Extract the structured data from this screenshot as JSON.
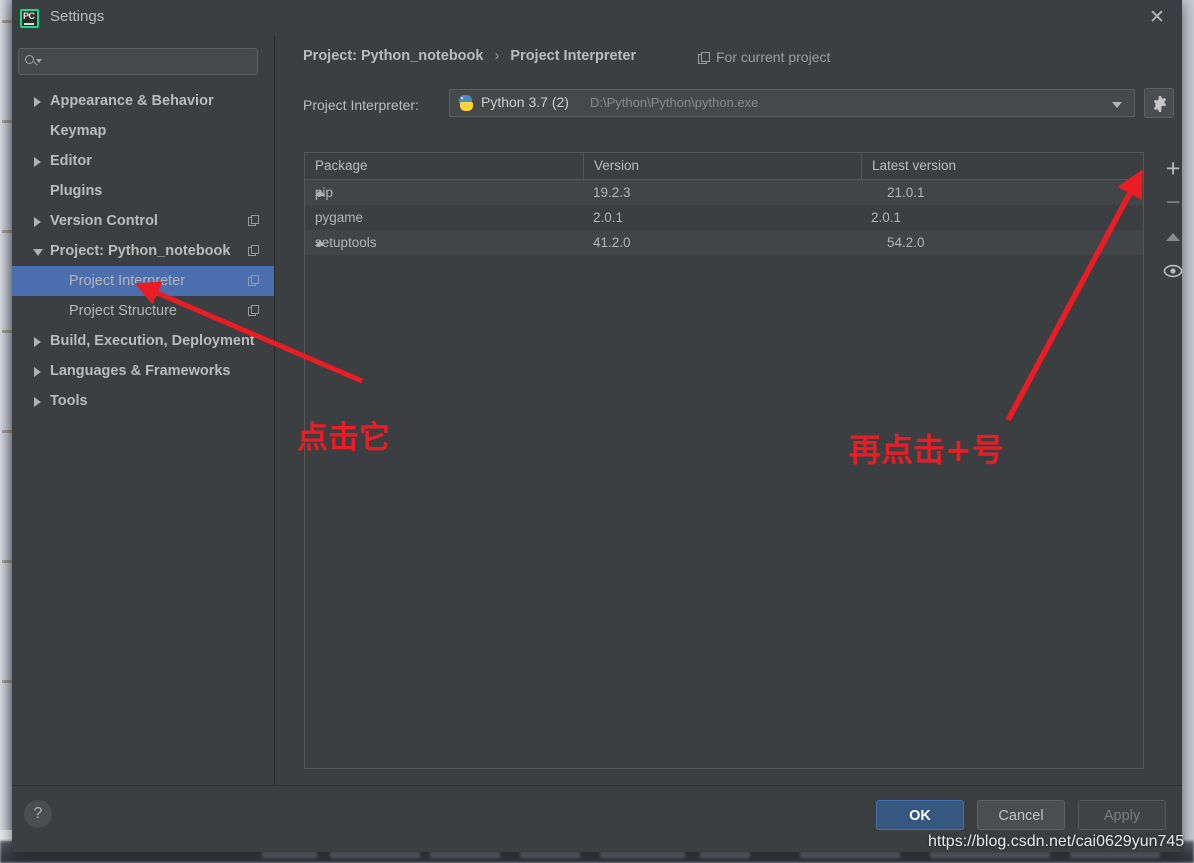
{
  "window": {
    "title": "Settings",
    "logo_icon": "pycharm-logo-icon",
    "close_icon": "close-icon"
  },
  "sidebar": {
    "search": {
      "value": "",
      "placeholder": "",
      "icon": "search-icon"
    },
    "items": [
      {
        "label": "Appearance & Behavior",
        "state": "collapsed",
        "bold": true,
        "child": false,
        "copy": false,
        "selected": false
      },
      {
        "label": "Keymap",
        "state": "none",
        "bold": true,
        "child": false,
        "copy": false,
        "selected": false
      },
      {
        "label": "Editor",
        "state": "collapsed",
        "bold": true,
        "child": false,
        "copy": false,
        "selected": false
      },
      {
        "label": "Plugins",
        "state": "none",
        "bold": true,
        "child": false,
        "copy": false,
        "selected": false
      },
      {
        "label": "Version Control",
        "state": "collapsed",
        "bold": true,
        "child": false,
        "copy": true,
        "selected": false
      },
      {
        "label": "Project: Python_notebook",
        "state": "expanded",
        "bold": true,
        "child": false,
        "copy": true,
        "selected": false
      },
      {
        "label": "Project Interpreter",
        "state": "none",
        "bold": false,
        "child": true,
        "copy": true,
        "selected": true
      },
      {
        "label": "Project Structure",
        "state": "none",
        "bold": false,
        "child": true,
        "copy": true,
        "selected": false
      },
      {
        "label": "Build, Execution, Deployment",
        "state": "collapsed",
        "bold": true,
        "child": false,
        "copy": false,
        "selected": false
      },
      {
        "label": "Languages & Frameworks",
        "state": "collapsed",
        "bold": true,
        "child": false,
        "copy": false,
        "selected": false
      },
      {
        "label": "Tools",
        "state": "collapsed",
        "bold": true,
        "child": false,
        "copy": false,
        "selected": false
      }
    ]
  },
  "main": {
    "breadcrumb_root": "Project: Python_notebook",
    "breadcrumb_sep": "›",
    "breadcrumb_leaf": "Project Interpreter",
    "for_current_project": "For current project",
    "interpreter_label": "Project Interpreter:",
    "interpreter_name": "Python 3.7 (2)",
    "interpreter_path": "D:\\Python\\Python\\python.exe",
    "gear_icon": "gear-icon",
    "dropdown_icon": "chevron-down-icon",
    "table": {
      "columns": [
        "Package",
        "Version",
        "Latest version"
      ],
      "rows": [
        {
          "package": "pip",
          "version": "19.2.3",
          "latest": "21.0.1",
          "upgradable": true
        },
        {
          "package": "pygame",
          "version": "2.0.1",
          "latest": "2.0.1",
          "upgradable": false
        },
        {
          "package": "setuptools",
          "version": "41.2.0",
          "latest": "54.2.0",
          "upgradable": true
        }
      ]
    },
    "toolbar": {
      "add_label": "+",
      "remove_label": "−",
      "upgrade_icon": "arrow-up-icon",
      "eye_icon": "eye-icon"
    }
  },
  "footer": {
    "help_label": "?",
    "ok_label": "OK",
    "cancel_label": "Cancel",
    "apply_label": "Apply"
  },
  "annotations": {
    "click_it": "点击它",
    "then_click_plus": "再点击+号"
  },
  "watermark": "https://blog.csdn.net/cai0629yun745",
  "colors": {
    "dialog_bg": "#3c3f41",
    "selection_blue": "#4b6eaf",
    "ok_button": "#365880",
    "annotation_red": "#ec1c24",
    "python_blue": "#4b8bbe",
    "python_yellow": "#ffd43b"
  }
}
